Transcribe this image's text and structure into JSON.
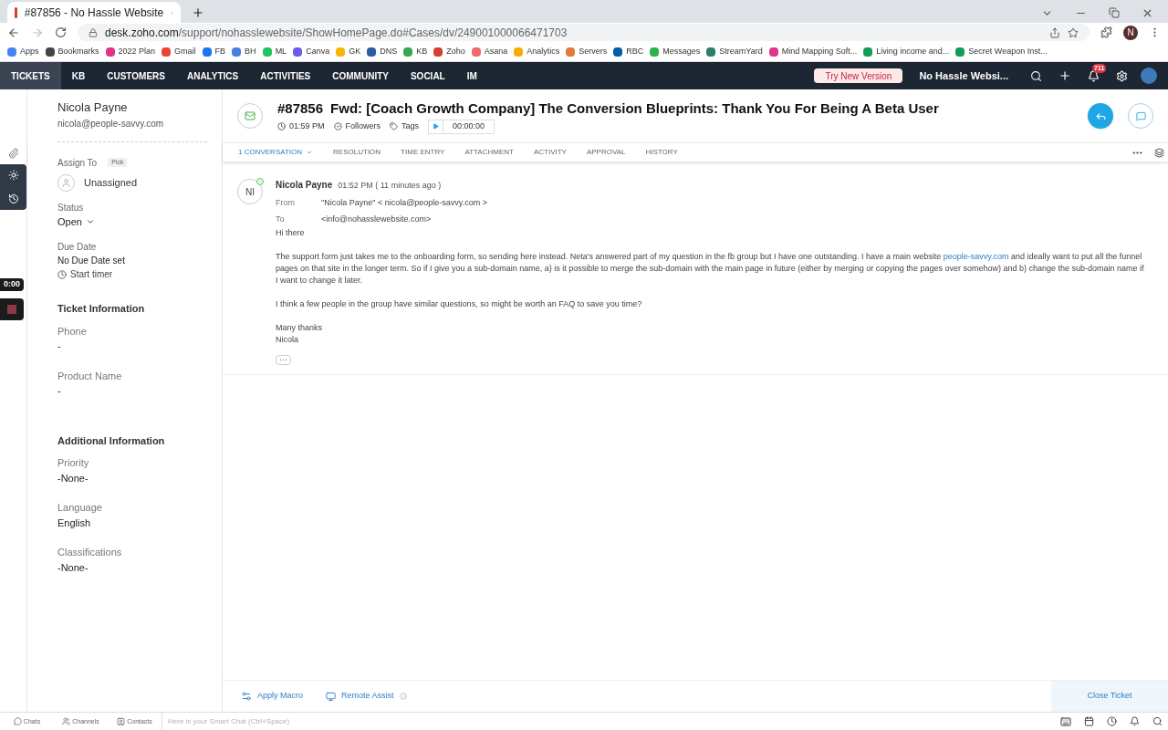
{
  "browser": {
    "tab_title": "#87856 - No Hassle Website",
    "url_host": "desk.zoho.com",
    "url_path": "/support/nohasslewebsite/ShowHomePage.do#Cases/dv/249001000066471703",
    "profile_initial": "N",
    "bookmarks": [
      {
        "label": "Apps",
        "color": "#4285f4"
      },
      {
        "label": "Bookmarks",
        "color": "#444444"
      },
      {
        "label": "2022 Plan",
        "color": "#e2338a"
      },
      {
        "label": "Gmail",
        "color": "#ea4335"
      },
      {
        "label": "FB",
        "color": "#1877f2"
      },
      {
        "label": "BH",
        "color": "#4a7fe0"
      },
      {
        "label": "ML",
        "color": "#22c55e"
      },
      {
        "label": "Canva",
        "color": "#6d5ce8"
      },
      {
        "label": "GK",
        "color": "#f5b800"
      },
      {
        "label": "DNS",
        "color": "#2a5d9f"
      },
      {
        "label": "KB",
        "color": "#3aa757"
      },
      {
        "label": "Zoho",
        "color": "#d23f31"
      },
      {
        "label": "Asana",
        "color": "#f06a6a"
      },
      {
        "label": "Analytics",
        "color": "#f9ab00"
      },
      {
        "label": "Servers",
        "color": "#e07a3a"
      },
      {
        "label": "RBC",
        "color": "#005daa"
      },
      {
        "label": "Messages",
        "color": "#2bb24c"
      },
      {
        "label": "StreamYard",
        "color": "#2f7d6d"
      },
      {
        "label": "Mind Mapping Soft...",
        "color": "#e2338a"
      },
      {
        "label": "Living income and...",
        "color": "#0f9d58"
      },
      {
        "label": "Secret Weapon Inst...",
        "color": "#0f9d58"
      }
    ]
  },
  "nav": {
    "tabs": [
      {
        "label": "TICKETS",
        "selected": true
      },
      {
        "label": "KB",
        "selected": false
      },
      {
        "label": "CUSTOMERS",
        "selected": false
      },
      {
        "label": "ANALYTICS",
        "selected": false
      },
      {
        "label": "ACTIVITIES",
        "selected": false
      },
      {
        "label": "COMMUNITY",
        "selected": false
      },
      {
        "label": "SOCIAL",
        "selected": false
      },
      {
        "label": "IM",
        "selected": false
      }
    ],
    "try_button": "Try New Version",
    "portal": "No Hassle Websi...",
    "notification_count": "711"
  },
  "timer_badge": "0:00",
  "contact": {
    "name": "Nicola Payne",
    "email": "nicola@people-savvy.com",
    "assign_label": "Assign To",
    "pick": "Pick",
    "assignee": "Unassigned",
    "status_label": "Status",
    "status": "Open",
    "due_label": "Due Date",
    "due": "No Due Date set",
    "start_timer": "Start timer"
  },
  "sections": [
    {
      "title": "Ticket Information",
      "fields": [
        {
          "label": "Phone",
          "value": "-"
        },
        {
          "label": "Product Name",
          "value": "-"
        }
      ]
    },
    {
      "title": "Additional Information",
      "fields": [
        {
          "label": "Priority",
          "value": "-None-"
        },
        {
          "label": "Language",
          "value": "English"
        },
        {
          "label": "Classifications",
          "value": "-None-"
        }
      ]
    }
  ],
  "ticket": {
    "number": "#87856",
    "subject": "Fwd: [Coach Growth Company] The Conversion Blueprints: Thank You For Being A Beta User",
    "time": "01:59 PM",
    "followers": "Followers",
    "tags": "Tags",
    "timer": "00:00:00"
  },
  "ticket_tabs": [
    {
      "label": "1 CONVERSATION",
      "selected": true
    },
    {
      "label": "RESOLUTION",
      "selected": false
    },
    {
      "label": "TIME ENTRY",
      "selected": false
    },
    {
      "label": "ATTACHMENT",
      "selected": false
    },
    {
      "label": "ACTIVITY",
      "selected": false
    },
    {
      "label": "APPROVAL",
      "selected": false
    },
    {
      "label": "HISTORY",
      "selected": false
    }
  ],
  "message": {
    "initials": "NI",
    "sender": "Nicola Payne",
    "time": "01:52 PM ( 11 minutes ago )",
    "from_label": "From",
    "from": "\"Nicola Payne\" < nicola@people-savvy.com >",
    "to_label": "To",
    "to": "<info@nohasslewebsite.com>",
    "greeting": "Hi there",
    "paragraph_before": "The support form just takes me to the onboarding form, so sending here instead.  Neta's answered part of my question in the fb group but I have one outstanding.  I have a main website",
    "paragraph_link": "people-savvy.com",
    "paragraph_after": "and ideally want to put all the funnel pages on that site in the longer term.  So if I give you a sub-domain name, a) is it possible to merge the sub-domain with the main page in future (either by merging or copying the pages over somehow) and b) change the sub-domain name if I want to change it later.",
    "paragraph_2": "I think a few people in the group have similar questions, so might be worth an FAQ to save you time?",
    "signoff": "Many thanks",
    "signature": "Nicola",
    "more": "···"
  },
  "footer": {
    "apply_macro": "Apply Macro",
    "remote_assist": "Remote Assist",
    "close_ticket": "Close Ticket"
  },
  "chat_bar": {
    "items": [
      "Chats",
      "Channels",
      "Contacts"
    ],
    "placeholder": "Here is your Smart Chat (Ctrl+Space)"
  }
}
